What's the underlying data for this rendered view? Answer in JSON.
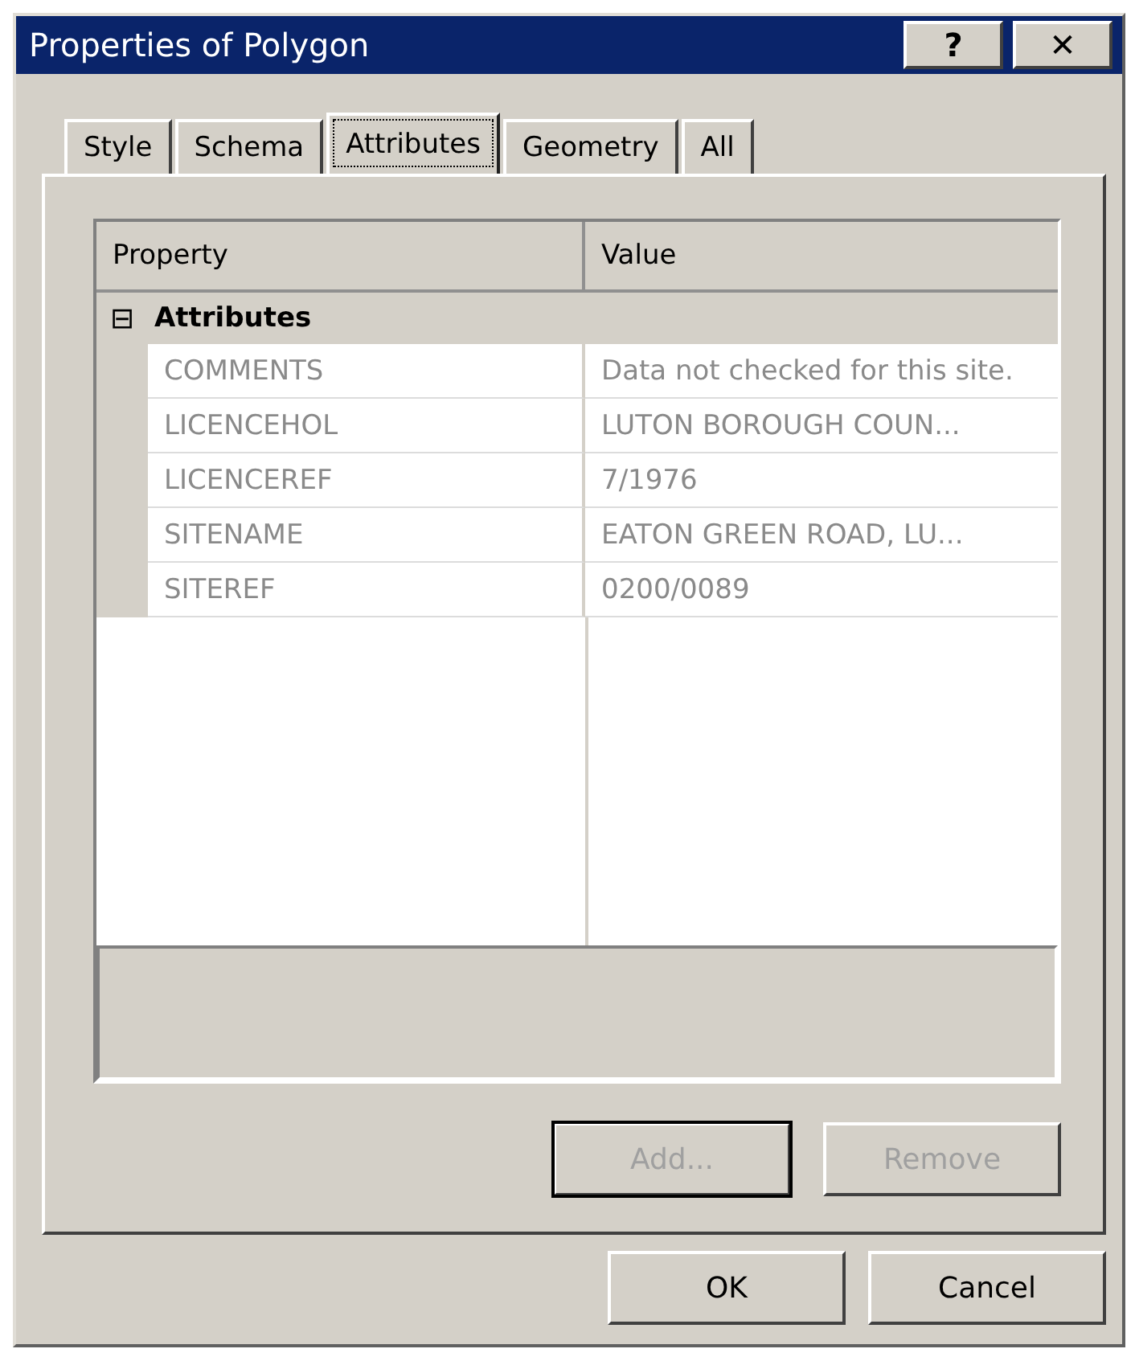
{
  "window": {
    "title": "Properties of Polygon",
    "title_buttons": [
      "?",
      "✕"
    ]
  },
  "tabs": [
    {
      "label": "Style",
      "selected": false
    },
    {
      "label": "Schema",
      "selected": false
    },
    {
      "label": "Attributes",
      "selected": true
    },
    {
      "label": "Geometry",
      "selected": false
    },
    {
      "label": "All",
      "selected": false
    }
  ],
  "grid": {
    "columns": [
      "Property",
      "Value"
    ],
    "groups": [
      {
        "toggle": "⊟",
        "name": "Attributes",
        "expanded": true,
        "rows": [
          {
            "property": "COMMENTS",
            "value": "Data not checked for this site.",
            "disabled": true
          },
          {
            "property": "LICENCEHOL",
            "value": "LUTON BOROUGH COUN...",
            "disabled": true
          },
          {
            "property": "LICENCEREF",
            "value": "7/1976",
            "disabled": true
          },
          {
            "property": "SITENAME",
            "value": "EATON GREEN ROAD, LU...",
            "disabled": true
          },
          {
            "property": "SITEREF",
            "value": "0200/0089",
            "disabled": true
          }
        ]
      }
    ]
  },
  "panel_buttons": [
    {
      "label": "Add...",
      "disabled": true,
      "default": true
    },
    {
      "label": "Remove",
      "disabled": true,
      "default": false
    }
  ],
  "dialog_buttons": [
    {
      "label": "OK",
      "disabled": false
    },
    {
      "label": "Cancel",
      "disabled": false
    }
  ]
}
